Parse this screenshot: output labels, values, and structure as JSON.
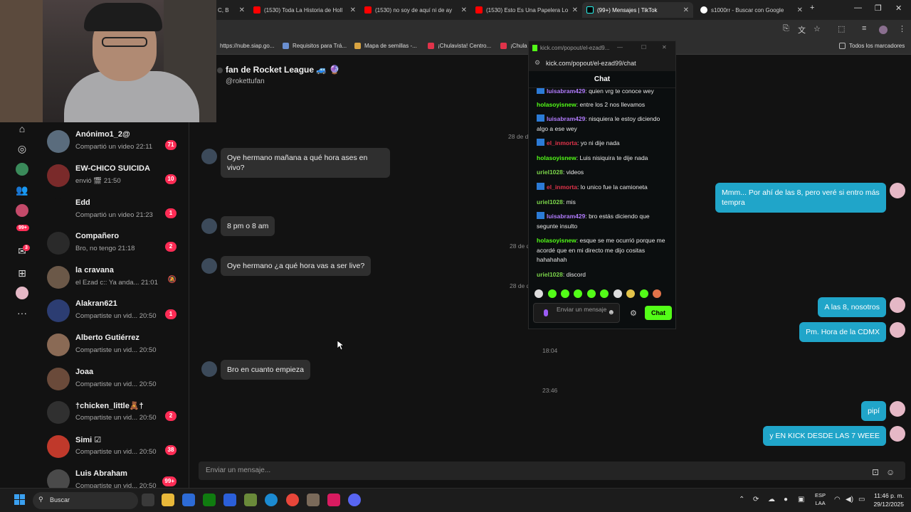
{
  "browser": {
    "tabs": [
      {
        "label": "C, B",
        "color": "#ffffff"
      },
      {
        "label": "(1530) Toda La Historia de Holl",
        "color": "#ff0000"
      },
      {
        "label": "(1530) no soy de aquí ni de ay",
        "color": "#ff0000"
      },
      {
        "label": "(1530) Esto Es Una Papelera Lo",
        "color": "#ff0000"
      },
      {
        "label": "(99+) Mensajes | TikTok",
        "color": "#111111"
      },
      {
        "label": "s1000rr - Buscar con Google",
        "color": "#4285f4"
      }
    ],
    "bookmarks": [
      "https://nube.siap.go...",
      "Requisitos para Trá...",
      "Mapa de semillas -...",
      "¡Chulavista! Centro...",
      "¡Chula",
      "Todos los marcadores"
    ]
  },
  "sidebar": {
    "badge_count": "99+",
    "inbox_badge": "3",
    "conversations": [
      {
        "name": "Anónimo1_2@",
        "sub": "Compartió un video",
        "time": "22:11",
        "badge": "71",
        "avatar_color": "#5a6c7d"
      },
      {
        "name": "EW-CHICO SUICIDA",
        "sub": "envió 🎬",
        "time": "21:50",
        "badge": "10",
        "avatar_color": "#7a2a2a"
      },
      {
        "name": "Edd",
        "sub": "Compartió un video",
        "time": "21:23",
        "badge": "1",
        "avatar_color": "#121212"
      },
      {
        "name": "Compañero",
        "sub": "Bro, no tengo",
        "time": "21:18",
        "badge": "2",
        "avatar_color": "#2a2a2a"
      },
      {
        "name": "la cravana",
        "sub": "el Ezad c:: Ya anda...",
        "time": "21:01",
        "badge": "",
        "avatar_color": "#6b5848"
      },
      {
        "name": "Alakran621",
        "sub": "Compartiste un vid...",
        "time": "20:50",
        "badge": "1",
        "avatar_color": "#2c3d72"
      },
      {
        "name": "Alberto Gutiérrez",
        "sub": "Compartiste un vid...",
        "time": "20:50",
        "badge": "",
        "avatar_color": "#8a6a55"
      },
      {
        "name": "Joaa",
        "sub": "Compartiste un vid...",
        "time": "20:50",
        "badge": "",
        "avatar_color": "#6a4a3a"
      },
      {
        "name": "†chicken_little🧸†",
        "sub": "Compartiste un vid...",
        "time": "20:50",
        "badge": "2",
        "avatar_color": "#303030"
      },
      {
        "name": "Simi ☑",
        "sub": "Compartiste un vid...",
        "time": "20:50",
        "badge": "38",
        "avatar_color": "#c0392b"
      },
      {
        "name": "Luis Abraham",
        "sub": "Compartiste un vid...",
        "time": "20:50",
        "badge": "99+",
        "avatar_color": "#4a4a4a"
      }
    ]
  },
  "chat": {
    "title": "fan de Rocket League 🚙 🔮",
    "handle": "@rokettufan",
    "timestamps": [
      "28 de d",
      "28 de d",
      "28 de d",
      "18:04",
      "23:46"
    ],
    "incoming": [
      "Oye hermano mañana a qué hora ases en vivo?",
      "8 pm o 8 am",
      "Oye hermano ¿a qué hora vas a ser live?",
      "Bro en cuanto empieza"
    ],
    "outgoing": [
      "Mmm... Por ahí de las 8, pero veré si entro más tempra",
      "A las 8, nosotros",
      "Pm. Hora de la CDMX",
      "pipí",
      "y EN KICK DESDE LAS 7 WEEE"
    ],
    "input_placeholder": "Enviar un mensaje..."
  },
  "kick": {
    "window_title": "kick.com/popout/el-ezad9...",
    "url": "kick.com/popout/el-ezad99/chat",
    "header": "Chat",
    "messages": [
      {
        "user": "luisabram429",
        "text": ": quien vrg te conoce wey",
        "color": "#b27cff",
        "badge": true
      },
      {
        "user": "holasoyisnew",
        "text": ": entre los 2 nos llevamos",
        "color": "#53fc18",
        "badge": false
      },
      {
        "user": "luisabram429",
        "text": ": nisquiera le estoy diciendo algo a ese wey",
        "color": "#b27cff",
        "badge": true
      },
      {
        "user": "el_inmorta",
        "text": ": yo ni dije nada",
        "color": "#e0334a",
        "badge": true
      },
      {
        "user": "holasoyisnew",
        "text": ": Luis nisiquira te dije nada",
        "color": "#53fc18",
        "badge": false
      },
      {
        "user": "uriel1028",
        "text": ": videos",
        "color": "#7cd64a",
        "badge": false
      },
      {
        "user": "el_inmorta",
        "text": ": lo unico fue la camioneta",
        "color": "#e0334a",
        "badge": true
      },
      {
        "user": "uriel1028",
        "text": ": mis",
        "color": "#7cd64a",
        "badge": false
      },
      {
        "user": "luisabram429",
        "text": ": bro estás diciendo que segunte insulto",
        "color": "#b27cff",
        "badge": true
      },
      {
        "user": "holasoyisnew",
        "text": ": esque se me ocurrió porque me acordé que en mi directo me dijo cositas hahahahah",
        "color": "#53fc18",
        "badge": false
      },
      {
        "user": "uriel1028",
        "text": ": discord",
        "color": "#7cd64a",
        "badge": false
      }
    ],
    "input_placeholder": "Enviar un mensaje",
    "send_label": "Chat"
  },
  "taskbar": {
    "search_label": "Buscar",
    "lang": "ESP",
    "lang_sub": "LAA",
    "time": "11:46 p. m.",
    "date": "29/12/2025"
  }
}
